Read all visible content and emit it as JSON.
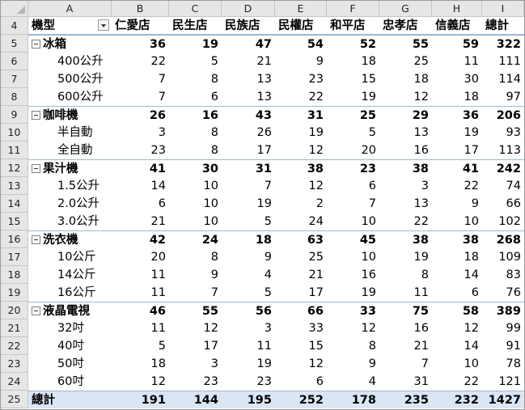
{
  "columns": [
    "A",
    "B",
    "C",
    "D",
    "E",
    "F",
    "G",
    "H",
    "I"
  ],
  "pivot": {
    "header_row_num": "4",
    "row_field": "機型",
    "stores": [
      "仁愛店",
      "民生店",
      "民族店",
      "民權店",
      "和平店",
      "忠孝店",
      "信義店",
      "總計"
    ],
    "rows": [
      {
        "row": "5",
        "type": "group",
        "label": "冰箱",
        "values": [
          "36",
          "19",
          "47",
          "54",
          "52",
          "55",
          "59",
          "322"
        ]
      },
      {
        "row": "6",
        "type": "item",
        "label": "400公升",
        "values": [
          "22",
          "5",
          "21",
          "9",
          "18",
          "25",
          "11",
          "111"
        ]
      },
      {
        "row": "7",
        "type": "item",
        "label": "500公升",
        "values": [
          "7",
          "8",
          "13",
          "23",
          "15",
          "18",
          "30",
          "114"
        ]
      },
      {
        "row": "8",
        "type": "item",
        "label": "600公升",
        "values": [
          "7",
          "6",
          "13",
          "22",
          "19",
          "12",
          "18",
          "97"
        ]
      },
      {
        "row": "9",
        "type": "group",
        "label": "咖啡機",
        "values": [
          "26",
          "16",
          "43",
          "31",
          "25",
          "29",
          "36",
          "206"
        ]
      },
      {
        "row": "10",
        "type": "item",
        "label": "半自動",
        "values": [
          "3",
          "8",
          "26",
          "19",
          "5",
          "13",
          "19",
          "93"
        ]
      },
      {
        "row": "11",
        "type": "item",
        "label": "全自動",
        "values": [
          "23",
          "8",
          "17",
          "12",
          "20",
          "16",
          "17",
          "113"
        ]
      },
      {
        "row": "12",
        "type": "group",
        "label": "果汁機",
        "values": [
          "41",
          "30",
          "31",
          "38",
          "23",
          "38",
          "41",
          "242"
        ]
      },
      {
        "row": "13",
        "type": "item",
        "label": "1.5公升",
        "values": [
          "14",
          "10",
          "7",
          "12",
          "6",
          "3",
          "22",
          "74"
        ]
      },
      {
        "row": "14",
        "type": "item",
        "label": "2.0公升",
        "values": [
          "6",
          "10",
          "19",
          "2",
          "7",
          "13",
          "9",
          "66"
        ]
      },
      {
        "row": "15",
        "type": "item",
        "label": "3.0公升",
        "values": [
          "21",
          "10",
          "5",
          "24",
          "10",
          "22",
          "10",
          "102"
        ]
      },
      {
        "row": "16",
        "type": "group",
        "label": "洗衣機",
        "values": [
          "42",
          "24",
          "18",
          "63",
          "45",
          "38",
          "38",
          "268"
        ]
      },
      {
        "row": "17",
        "type": "item",
        "label": "10公斤",
        "values": [
          "20",
          "8",
          "9",
          "25",
          "10",
          "19",
          "18",
          "109"
        ]
      },
      {
        "row": "18",
        "type": "item",
        "label": "14公斤",
        "values": [
          "11",
          "9",
          "4",
          "21",
          "16",
          "8",
          "14",
          "83"
        ]
      },
      {
        "row": "19",
        "type": "item",
        "label": "16公斤",
        "values": [
          "11",
          "7",
          "5",
          "17",
          "19",
          "11",
          "6",
          "76"
        ]
      },
      {
        "row": "20",
        "type": "group",
        "label": "液晶電視",
        "values": [
          "46",
          "55",
          "56",
          "66",
          "33",
          "75",
          "58",
          "389"
        ]
      },
      {
        "row": "21",
        "type": "item",
        "label": "32吋",
        "values": [
          "11",
          "12",
          "3",
          "33",
          "12",
          "16",
          "12",
          "99"
        ]
      },
      {
        "row": "22",
        "type": "item",
        "label": "40吋",
        "values": [
          "5",
          "17",
          "11",
          "15",
          "8",
          "21",
          "14",
          "91"
        ]
      },
      {
        "row": "23",
        "type": "item",
        "label": "50吋",
        "values": [
          "18",
          "3",
          "19",
          "12",
          "9",
          "7",
          "10",
          "78"
        ]
      },
      {
        "row": "24",
        "type": "item",
        "label": "60吋",
        "values": [
          "12",
          "23",
          "23",
          "6",
          "4",
          "31",
          "22",
          "121"
        ]
      },
      {
        "row": "25",
        "type": "total",
        "label": "總計",
        "values": [
          "191",
          "144",
          "195",
          "252",
          "178",
          "235",
          "232",
          "1427"
        ]
      }
    ]
  }
}
